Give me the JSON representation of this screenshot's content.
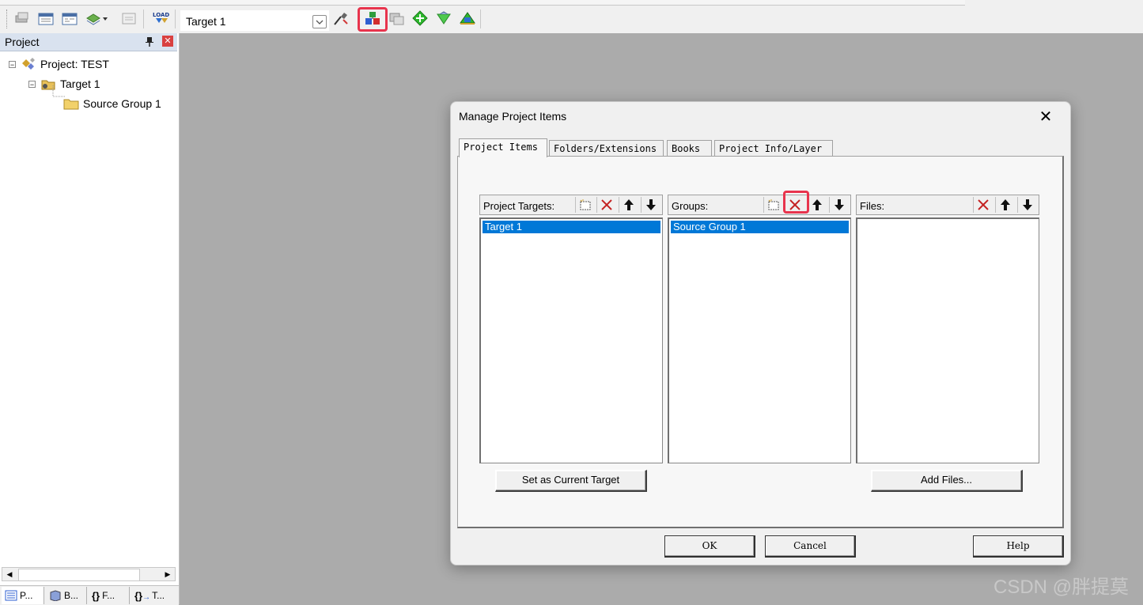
{
  "toolbar": {
    "target_value": "Target 1",
    "load_label": "LOAD"
  },
  "project_panel": {
    "title": "Project",
    "tree": [
      {
        "label": "Project: TEST"
      },
      {
        "label": "Target 1"
      },
      {
        "label": "Source Group 1"
      }
    ],
    "tabs": [
      {
        "label": "P..."
      },
      {
        "label": "B..."
      },
      {
        "label": "F..."
      },
      {
        "label": "T..."
      }
    ]
  },
  "dialog": {
    "title": "Manage Project Items",
    "tabs": [
      {
        "label": "Project Items"
      },
      {
        "label": "Folders/Extensions"
      },
      {
        "label": "Books"
      },
      {
        "label": "Project Info/Layer"
      }
    ],
    "targets": {
      "header": "Project Targets:",
      "items": [
        "Target 1"
      ],
      "button": "Set as Current Target"
    },
    "groups": {
      "header": "Groups:",
      "items": [
        "Source Group 1"
      ]
    },
    "files": {
      "header": "Files:",
      "items": [],
      "button": "Add Files..."
    },
    "footer": {
      "ok": "OK",
      "cancel": "Cancel",
      "help": "Help"
    }
  },
  "watermark": "CSDN @胖提莫",
  "colors": {
    "highlight": "#e8344d",
    "selection": "#0078d7",
    "workspace": "#ababab"
  }
}
